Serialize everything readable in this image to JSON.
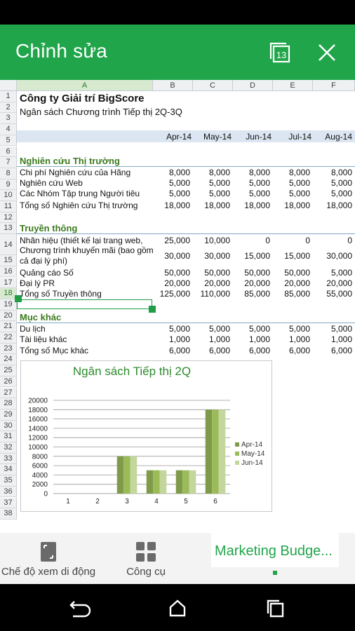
{
  "appbar": {
    "title": "Chỉnh sửa",
    "sheets_count": "13"
  },
  "columns": [
    "A",
    "B",
    "C",
    "D",
    "E",
    "F"
  ],
  "rows": [
    "1",
    "2",
    "3",
    "4",
    "5",
    "6",
    "7",
    "8",
    "9",
    "10",
    "11",
    "12",
    "13",
    "14",
    "15",
    "16",
    "17",
    "18",
    "19",
    "20",
    "21",
    "22",
    "23",
    "24",
    "25",
    "26",
    "27",
    "28",
    "29",
    "30",
    "31",
    "32",
    "33",
    "34",
    "35",
    "36",
    "37",
    "38"
  ],
  "sheet": {
    "title": "Công ty Giải trí BigScore",
    "subtitle": "Ngân sách Chương trình Tiếp thị 2Q-3Q",
    "months": [
      "Apr-14",
      "May-14",
      "Jun-14",
      "Jul-14",
      "Aug-14"
    ],
    "sec1": {
      "name": "Nghiên cứu Thị trường"
    },
    "r7": {
      "label": "Chi phí Nghiên cứu của Hãng",
      "v": [
        "8,000",
        "8,000",
        "8,000",
        "8,000",
        "8,000"
      ]
    },
    "r8": {
      "label": "Nghiên cứu Web",
      "v": [
        "5,000",
        "5,000",
        "5,000",
        "5,000",
        "5,000"
      ]
    },
    "r9": {
      "label": "Các Nhóm Tập trung Người tiêu",
      "v": [
        "5,000",
        "5,000",
        "5,000",
        "5,000",
        "5,000"
      ]
    },
    "r10": {
      "label": "Tổng số Nghiên cứu Thị trường",
      "v": [
        "18,000",
        "18,000",
        "18,000",
        "18,000",
        "18,000"
      ]
    },
    "sec2": {
      "name": "Truyền thông"
    },
    "r13": {
      "label": "Nhãn hiệu (thiết kế lại trang web,",
      "v": [
        "25,000",
        "10,000",
        "0",
        "0",
        "0"
      ]
    },
    "r14": {
      "label1": "Chương trình khuyến mãi (bao gồm",
      "label2": "cả đại lý phí)",
      "v": [
        "30,000",
        "30,000",
        "15,000",
        "15,000",
        "30,000"
      ]
    },
    "r15": {
      "label": "Quảng cáo Số",
      "v": [
        "50,000",
        "50,000",
        "50,000",
        "50,000",
        "5,000"
      ]
    },
    "r16": {
      "label": "Đại lý PR",
      "v": [
        "20,000",
        "20,000",
        "20,000",
        "20,000",
        "20,000"
      ]
    },
    "r17": {
      "label": "Tổng số Truyền thông",
      "v": [
        "125,000",
        "110,000",
        "85,000",
        "85,000",
        "55,000"
      ]
    },
    "sec3": {
      "name": "Mục khác"
    },
    "r20": {
      "label": "Du lịch",
      "v": [
        "5,000",
        "5,000",
        "5,000",
        "5,000",
        "5,000"
      ]
    },
    "r21": {
      "label": "Tài liệu khác",
      "v": [
        "1,000",
        "1,000",
        "1,000",
        "1,000",
        "1,000"
      ]
    },
    "r22": {
      "label": "Tổng số Mục khác",
      "v": [
        "6,000",
        "6,000",
        "6,000",
        "6,000",
        "6,000"
      ]
    }
  },
  "chart_data": {
    "type": "bar",
    "title": "Ngân sách Tiếp thị 2Q",
    "categories": [
      "1",
      "2",
      "3",
      "4",
      "5",
      "6"
    ],
    "series": [
      {
        "name": "Apr-14",
        "values": [
          0,
          0,
          8000,
          5000,
          5000,
          18000
        ],
        "color": "#7f9a48"
      },
      {
        "name": "May-14",
        "values": [
          0,
          0,
          8000,
          5000,
          5000,
          18000
        ],
        "color": "#9bbb59"
      },
      {
        "name": "Jun-14",
        "values": [
          0,
          0,
          8000,
          5000,
          5000,
          18000
        ],
        "color": "#c3d69b"
      }
    ],
    "yticks": [
      "20000",
      "18000",
      "16000",
      "14000",
      "12000",
      "10000",
      "8000",
      "6000",
      "4000",
      "2000",
      "0"
    ],
    "ylim": [
      0,
      20000
    ],
    "legend": "right"
  },
  "bottom": {
    "mobile_view": "Chế độ xem di động",
    "tools": "Công cụ",
    "sheet_tab": "Marketing Budge..."
  }
}
